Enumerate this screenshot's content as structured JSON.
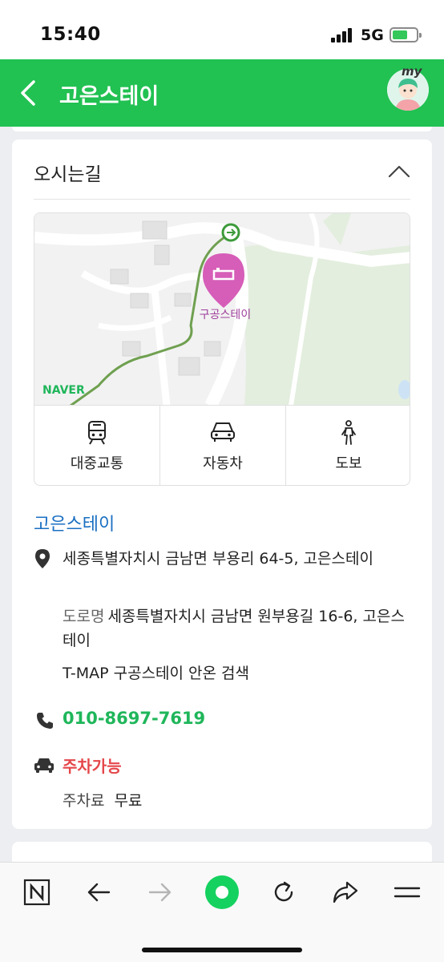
{
  "status_bar": {
    "time": "15:40",
    "network": "5G"
  },
  "header": {
    "title": "고은스테이",
    "my_label": "my"
  },
  "section": {
    "title": "오시는길",
    "map": {
      "pin_label": "구공스테이",
      "brand": "NAVER"
    },
    "modes": [
      {
        "label": "대중교통",
        "icon": "train-icon"
      },
      {
        "label": "자동차",
        "icon": "car-icon"
      },
      {
        "label": "도보",
        "icon": "walk-icon"
      }
    ],
    "place_name": "고은스테이",
    "address_jibun": "세종특별자치시 금남면 부용리 64-5, 고은스테이",
    "road_tag": "도로명",
    "address_road": "세종특별자치시 금남면 원부용길 16-6, 고은스테이",
    "tmap": "T-MAP 구공스테이 안온 검색",
    "phone": "010-8697-7619",
    "parking": "주차가능",
    "fee_label": "주차료",
    "fee_value": "무료"
  },
  "colors": {
    "brand_green": "#21c152",
    "link_blue": "#1a6fc2",
    "phone_green": "#1fb65a",
    "parking_red": "#e5474b"
  },
  "toolbar_icons": [
    "naver-n-icon",
    "back-arrow-icon",
    "forward-arrow-icon",
    "green-dot-icon",
    "refresh-icon",
    "share-icon",
    "menu-icon"
  ]
}
